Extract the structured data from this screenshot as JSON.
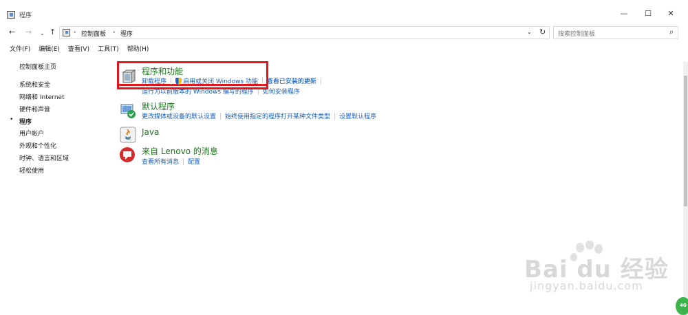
{
  "window": {
    "title": "程序",
    "minimize_glyph": "—",
    "maximize_glyph": "☐",
    "close_glyph": "✕"
  },
  "nav": {
    "back": "←",
    "forward": "→",
    "recent": "⌄",
    "up": "↑"
  },
  "address": {
    "crumbs": [
      "控制面板",
      "程序"
    ],
    "sep": "›",
    "dropdown": "⌄",
    "refresh": "↻"
  },
  "search": {
    "placeholder": "搜索控制面板",
    "icon": "⌕"
  },
  "menu": [
    "文件(F)",
    "编辑(E)",
    "查看(V)",
    "工具(T)",
    "帮助(H)"
  ],
  "sidebar": {
    "home": "控制面板主页",
    "items": [
      "系统和安全",
      "网络和 Internet",
      "硬件和声音",
      "程序",
      "用户帐户",
      "外观和个性化",
      "时钟、语言和区域",
      "轻松使用"
    ],
    "active_index": 3,
    "bullet": "•"
  },
  "categories": {
    "programs": {
      "title": "程序和功能",
      "links": [
        "卸载程序",
        "启用或关闭 Windows 功能",
        "查看已安装的更新"
      ],
      "links2": [
        "运行为以前版本的 Windows 编写的程序",
        "如何安装程序"
      ]
    },
    "defaults": {
      "title": "默认程序",
      "links": [
        "更改媒体或设备的默认设置",
        "始终使用指定的程序打开某种文件类型",
        "设置默认程序"
      ]
    },
    "java": {
      "title": "Java"
    },
    "lenovo": {
      "title": "来自 Lenovo 的消息",
      "links": [
        "查看所有消息",
        "配置"
      ]
    }
  },
  "watermark": {
    "main": "Bai du 经验",
    "sub": "jingyan.baidu.com"
  },
  "badge": "40",
  "colors": {
    "link": "#1a5fbf",
    "category_title": "#1a7a1a",
    "highlight": "#e1161c"
  }
}
